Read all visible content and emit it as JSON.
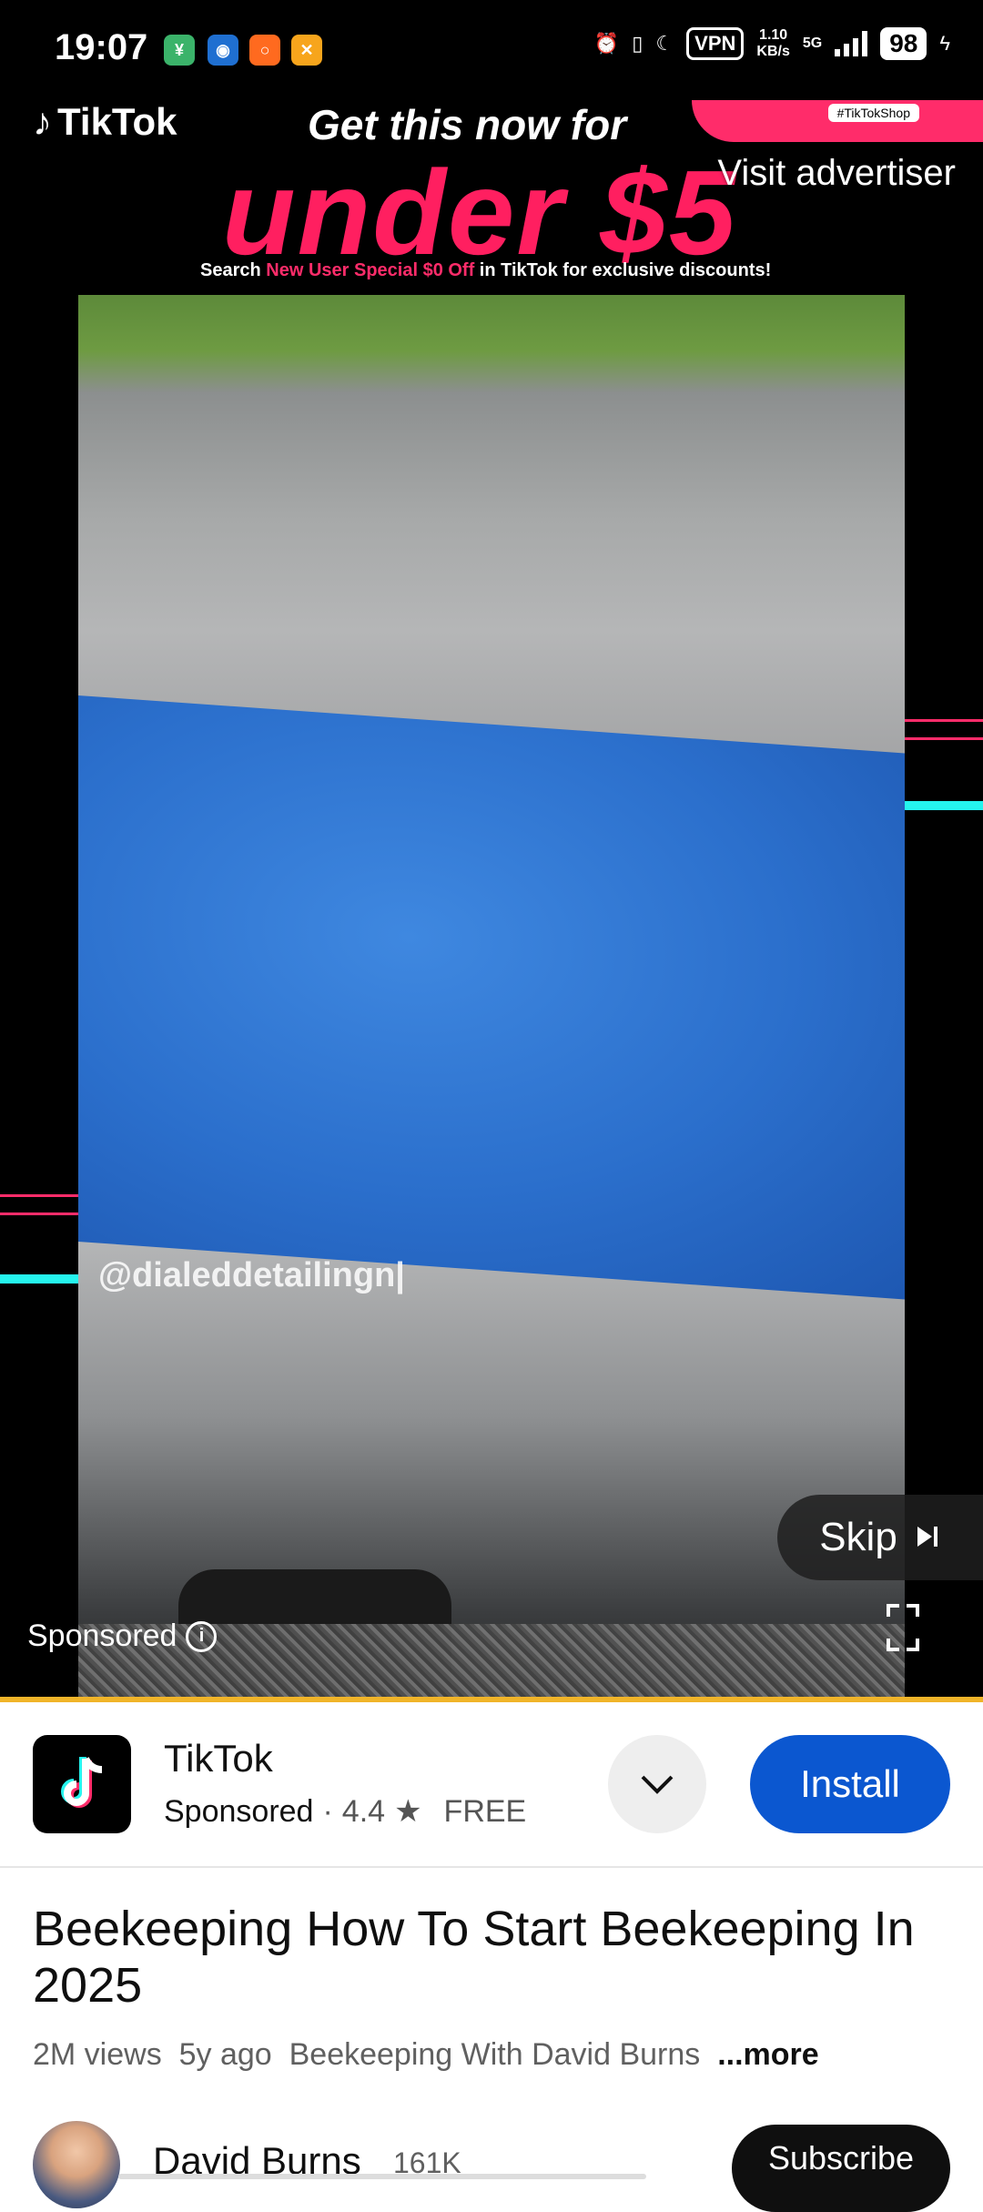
{
  "status_bar": {
    "time": "19:07",
    "vpn": "VPN",
    "speed_value": "1.10",
    "speed_unit": "KB/s",
    "network": "5G",
    "battery": "98"
  },
  "ad_video": {
    "brand": "TikTok",
    "headline": "Get this now for",
    "price_text": "under $5",
    "search_prefix": "Search ",
    "search_highlight": "New User Special $0 Off",
    "search_suffix": " in TikTok for exclusive discounts!",
    "shop_tag": "#TikTokShop",
    "visit_label": "Visit advertiser",
    "watermark": "@dialeddetailingn|",
    "skip_label": "Skip",
    "sponsored_label": "Sponsored"
  },
  "ad_card": {
    "app_name": "TikTok",
    "sponsored": "Sponsored",
    "dot": "·",
    "rating": "4.4",
    "star": "★",
    "price": "FREE",
    "install_label": "Install"
  },
  "video": {
    "title": "Beekeeping How To Start Beekeeping In 2025",
    "views": "2M views",
    "age": "5y ago",
    "channel_inline": "Beekeeping With David Burns",
    "more_label": "...more"
  },
  "channel": {
    "name": "David Burns",
    "subscribers": "161K",
    "subscribe_label": "Subscribe"
  },
  "colors": {
    "accent_blue": "#0b57d0",
    "tiktok_pink": "#ff1f60",
    "tiktok_cyan": "#25f4ee",
    "progress": "#f0b429"
  }
}
